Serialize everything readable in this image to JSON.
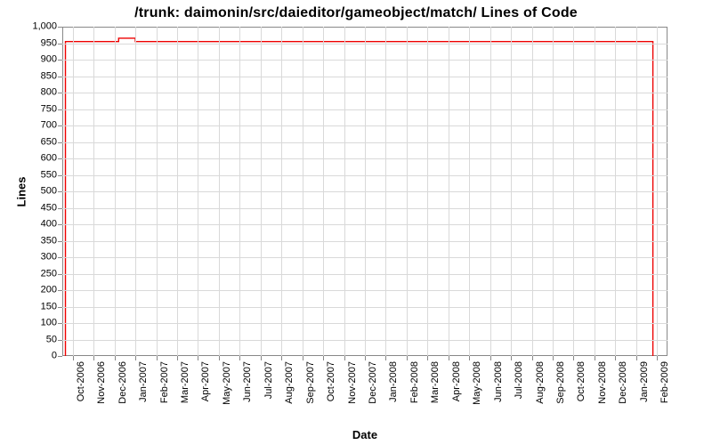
{
  "chart_data": {
    "type": "line",
    "title": "/trunk: daimonin/src/daieditor/gameobject/match/ Lines of Code",
    "xlabel": "Date",
    "ylabel": "Lines",
    "ylim": [
      0,
      1000
    ],
    "y_ticks": [
      0,
      50,
      100,
      150,
      200,
      250,
      300,
      350,
      400,
      450,
      500,
      550,
      600,
      650,
      700,
      750,
      800,
      850,
      900,
      950,
      1000
    ],
    "categories": [
      "Oct-2006",
      "Nov-2006",
      "Dec-2006",
      "Jan-2007",
      "Feb-2007",
      "Mar-2007",
      "Apr-2007",
      "May-2007",
      "Jun-2007",
      "Jul-2007",
      "Aug-2007",
      "Sep-2007",
      "Oct-2007",
      "Nov-2007",
      "Dec-2007",
      "Jan-2008",
      "Feb-2008",
      "Mar-2008",
      "Apr-2008",
      "May-2008",
      "Jun-2008",
      "Jul-2008",
      "Aug-2008",
      "Sep-2008",
      "Oct-2008",
      "Nov-2008",
      "Dec-2008",
      "Jan-2009",
      "Feb-2009"
    ],
    "series": [
      {
        "name": "Lines of Code",
        "color": "#ee0000",
        "points": [
          {
            "x_index": 0.15,
            "y": 0
          },
          {
            "x_index": 0.15,
            "y": 955
          },
          {
            "x_index": 2.7,
            "y": 955
          },
          {
            "x_index": 2.7,
            "y": 965
          },
          {
            "x_index": 3.5,
            "y": 965
          },
          {
            "x_index": 3.5,
            "y": 955
          },
          {
            "x_index": 28.3,
            "y": 955
          },
          {
            "x_index": 28.3,
            "y": 0
          }
        ]
      }
    ],
    "y_tick_labels": [
      "0",
      "50",
      "100",
      "150",
      "200",
      "250",
      "300",
      "350",
      "400",
      "450",
      "500",
      "550",
      "600",
      "650",
      "700",
      "750",
      "800",
      "850",
      "900",
      "950",
      "1,000"
    ],
    "x_domain": [
      0,
      29
    ]
  }
}
